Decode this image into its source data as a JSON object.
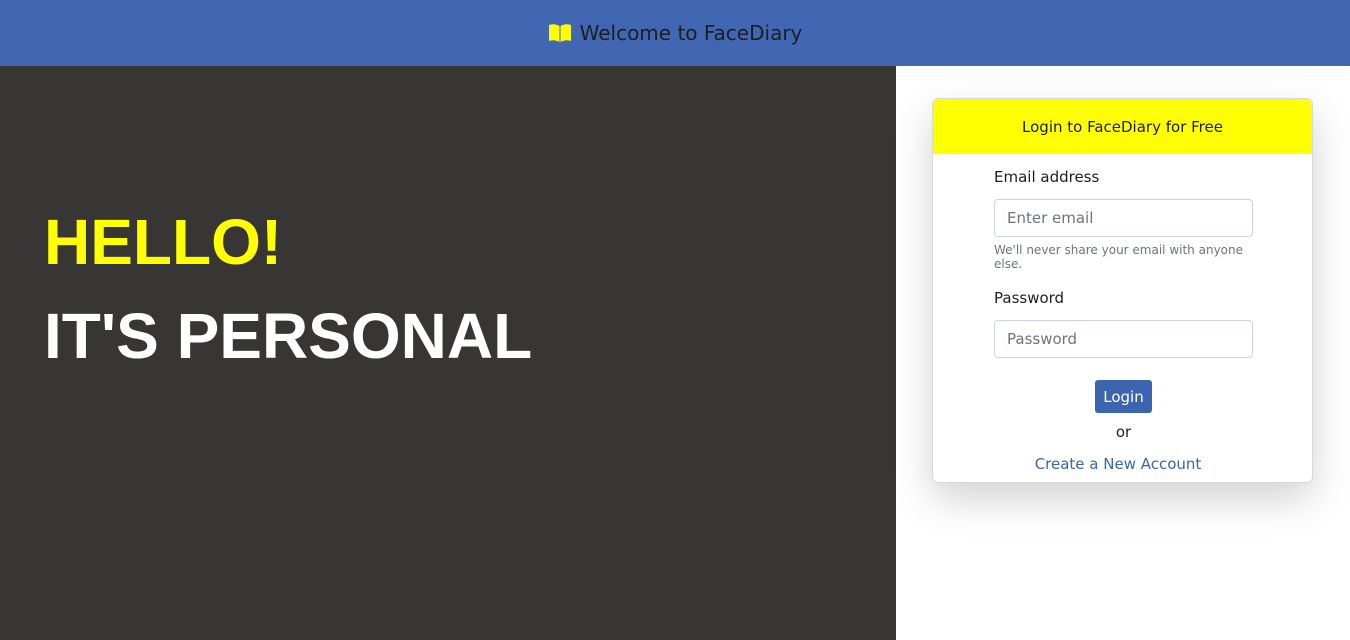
{
  "navbar": {
    "brand_icon": "open-book-icon",
    "brand_title": "Welcome to FaceDiary",
    "background_color": "#4267b2"
  },
  "hero": {
    "greeting": "HELLO!",
    "tagline": "IT'S PERSONAL",
    "greeting_color": "#ffff00",
    "tagline_color": "#ffffff",
    "background_color": "#383634"
  },
  "login_card": {
    "header": "Login to FaceDiary for Free",
    "header_color": "#ffff00",
    "email_label": "Email address",
    "email_placeholder": "Enter email",
    "email_value": "",
    "email_help": "We'll never share your email with anyone else.",
    "password_label": "Password",
    "password_placeholder": "Password",
    "password_value": "",
    "login_button": "Login",
    "button_color": "#3b65b0",
    "separator": "or",
    "create_account_link": "Create a New Account"
  }
}
